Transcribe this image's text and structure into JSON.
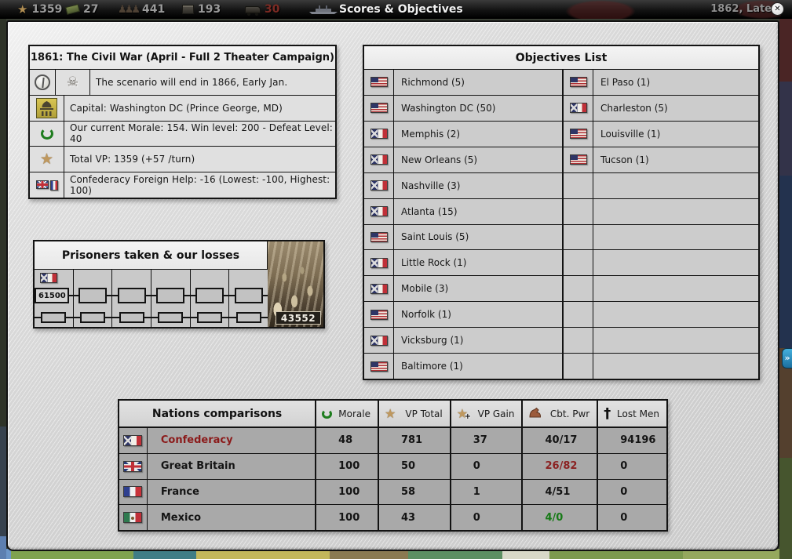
{
  "top_bar": {
    "title": "Scores & Objectives",
    "date": "1862, Late",
    "close_glyph": "✕",
    "side_button_glyph": "»",
    "resources": [
      {
        "name": "victory-points",
        "value": "1359",
        "color": "#9b9b9b"
      },
      {
        "name": "money",
        "value": "27",
        "color": "#9b9b9b"
      },
      {
        "name": "conscripts",
        "value": "441",
        "color": "#9b9b9b"
      },
      {
        "name": "war-supplies",
        "value": "193",
        "color": "#9b9b9b"
      },
      {
        "name": "transport",
        "value": "30",
        "color": "#7d2b24"
      }
    ],
    "men_glyphs": "♟♟♟"
  },
  "scenario_panel": {
    "title": "1861: The Civil War (April - Full 2 Theater Campaign)",
    "rows": [
      {
        "text": "The scenario will end in 1866, Early Jan."
      },
      {
        "text": "Capital: Washington DC (Prince George, MD)"
      },
      {
        "text": "Our current Morale: 154. Win level: 200 - Defeat Level: 40"
      },
      {
        "text": "Total VP: 1359 (+57 /turn)"
      },
      {
        "text": "Confederacy Foreign Help: -16  (Lowest: -100, Highest: 100)"
      }
    ],
    "star_glyph": "★",
    "skull_glyph": "☠"
  },
  "prisoners_panel": {
    "title": "Prisoners taken & our losses",
    "first_entry": {
      "flag": "csa",
      "value": "61500"
    },
    "losses_value": "43552"
  },
  "objectives_panel": {
    "title": "Objectives List",
    "left": [
      {
        "flag": "usa",
        "name": "Richmond (5)"
      },
      {
        "flag": "usa",
        "name": "Washington DC (50)"
      },
      {
        "flag": "csa",
        "name": "Memphis (2)"
      },
      {
        "flag": "csa",
        "name": "New Orleans (5)"
      },
      {
        "flag": "csa",
        "name": "Nashville (3)"
      },
      {
        "flag": "csa",
        "name": "Atlanta (15)"
      },
      {
        "flag": "usa",
        "name": "Saint Louis (5)"
      },
      {
        "flag": "csa",
        "name": "Little Rock (1)"
      },
      {
        "flag": "csa",
        "name": "Mobile (3)"
      },
      {
        "flag": "usa",
        "name": "Norfolk (1)"
      },
      {
        "flag": "csa",
        "name": "Vicksburg (1)"
      },
      {
        "flag": "usa",
        "name": "Baltimore (1)"
      }
    ],
    "right": [
      {
        "flag": "usa",
        "name": "El Paso (1)"
      },
      {
        "flag": "csa",
        "name": "Charleston (5)"
      },
      {
        "flag": "usa",
        "name": "Louisville (1)"
      },
      {
        "flag": "usa",
        "name": "Tucson (1)"
      },
      {
        "flag": "",
        "name": ""
      },
      {
        "flag": "",
        "name": ""
      },
      {
        "flag": "",
        "name": ""
      },
      {
        "flag": "",
        "name": ""
      },
      {
        "flag": "",
        "name": ""
      },
      {
        "flag": "",
        "name": ""
      },
      {
        "flag": "",
        "name": ""
      },
      {
        "flag": "",
        "name": ""
      }
    ]
  },
  "nations_panel": {
    "title": "Nations comparisons",
    "columns": [
      {
        "label": "Morale"
      },
      {
        "label": "VP Total"
      },
      {
        "label": "VP Gain"
      },
      {
        "label": "Cbt. Pwr"
      },
      {
        "label": "Lost Men"
      }
    ],
    "star_glyph": "★",
    "cross_glyph": "†",
    "rows": [
      {
        "flag": "csa",
        "name": "Confederacy",
        "name_color": "#8b1a1a",
        "morale": "48",
        "vp_total": "781",
        "vp_gain": "37",
        "cbt_pwr": "40/17",
        "cbt_color": "#141414",
        "lost_men": "94196"
      },
      {
        "flag": "gbr",
        "name": "Great Britain",
        "name_color": "#141414",
        "morale": "100",
        "vp_total": "50",
        "vp_gain": "0",
        "cbt_pwr": "26/82",
        "cbt_color": "#8b2222",
        "lost_men": "0"
      },
      {
        "flag": "fra",
        "name": "France",
        "name_color": "#141414",
        "morale": "100",
        "vp_total": "58",
        "vp_gain": "1",
        "cbt_pwr": "4/51",
        "cbt_color": "#141414",
        "lost_men": "0"
      },
      {
        "flag": "mex",
        "name": "Mexico",
        "name_color": "#141414",
        "morale": "100",
        "vp_total": "43",
        "vp_gain": "0",
        "cbt_pwr": "4/0",
        "cbt_color": "#177a17",
        "lost_men": "0"
      }
    ]
  }
}
